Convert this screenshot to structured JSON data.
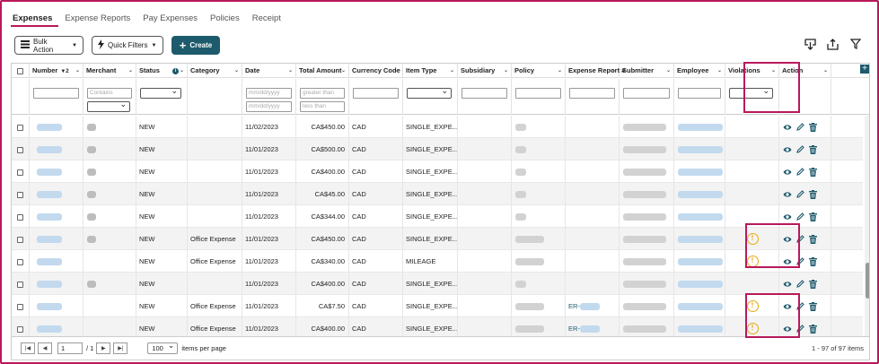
{
  "tabs": [
    "Expenses",
    "Expense Reports",
    "Pay Expenses",
    "Policies",
    "Receipt"
  ],
  "toolbar": {
    "bulk_action": "Bulk Action",
    "quick_filters": "Quick Filters",
    "create": "Create"
  },
  "columns": [
    "",
    "Number",
    "Merchant",
    "Status",
    "Category",
    "Date",
    "Total Amount",
    "Currency Code",
    "Item Type",
    "Subsidiary",
    "Policy",
    "Expense Report #",
    "Submitter",
    "Employee",
    "Violations",
    "Action"
  ],
  "number_sort_indicator": "▼2",
  "filters": {
    "merchant_placeholder": "Contains",
    "date_from_placeholder": "mm/dd/yyyy",
    "date_to_placeholder": "mm/dd/yyyy",
    "amount_from_placeholder": "greater than",
    "amount_to_placeholder": "less than"
  },
  "rows": [
    {
      "status": "NEW",
      "category": "",
      "date": "11/02/2023",
      "amount": "CA$450.00",
      "currency": "CAD",
      "item_type": "SINGLE_EXPE...",
      "expense_report": "",
      "violation": false
    },
    {
      "status": "NEW",
      "category": "",
      "date": "11/01/2023",
      "amount": "CA$500.00",
      "currency": "CAD",
      "item_type": "SINGLE_EXPE...",
      "expense_report": "",
      "violation": false
    },
    {
      "status": "NEW",
      "category": "",
      "date": "11/01/2023",
      "amount": "CA$400.00",
      "currency": "CAD",
      "item_type": "SINGLE_EXPE...",
      "expense_report": "",
      "violation": false
    },
    {
      "status": "NEW",
      "category": "",
      "date": "11/01/2023",
      "amount": "CA$45.00",
      "currency": "CAD",
      "item_type": "SINGLE_EXPE...",
      "expense_report": "",
      "violation": false
    },
    {
      "status": "NEW",
      "category": "",
      "date": "11/01/2023",
      "amount": "CA$344.00",
      "currency": "CAD",
      "item_type": "SINGLE_EXPE...",
      "expense_report": "",
      "violation": false
    },
    {
      "status": "NEW",
      "category": "Office Expense",
      "date": "11/01/2023",
      "amount": "CA$450.00",
      "currency": "CAD",
      "item_type": "SINGLE_EXPE...",
      "expense_report": "",
      "violation": true
    },
    {
      "status": "NEW",
      "category": "Office Expense",
      "date": "11/01/2023",
      "amount": "CA$340.00",
      "currency": "CAD",
      "item_type": "MILEAGE",
      "expense_report": "",
      "violation": true
    },
    {
      "status": "NEW",
      "category": "",
      "date": "11/01/2023",
      "amount": "CA$400.00",
      "currency": "CAD",
      "item_type": "SINGLE_EXPE...",
      "expense_report": "",
      "violation": false
    },
    {
      "status": "NEW",
      "category": "Office Expense",
      "date": "11/01/2023",
      "amount": "CA$7.50",
      "currency": "CAD",
      "item_type": "SINGLE_EXPE...",
      "expense_report": "ER-",
      "violation": true
    },
    {
      "status": "NEW",
      "category": "Office Expense",
      "date": "11/01/2023",
      "amount": "CA$400.00",
      "currency": "CAD",
      "item_type": "SINGLE_EXPE...",
      "expense_report": "ER-",
      "violation": true
    }
  ],
  "violation_glyph": "!",
  "pager": {
    "page": "1",
    "total_pages": "/ 1",
    "page_size": "100",
    "items_per_page": "items per page",
    "info": "1 - 97 of 97 items"
  },
  "colors": {
    "accent": "#b8195b",
    "primary": "#1d5a6b",
    "warning": "#e8a80c"
  }
}
